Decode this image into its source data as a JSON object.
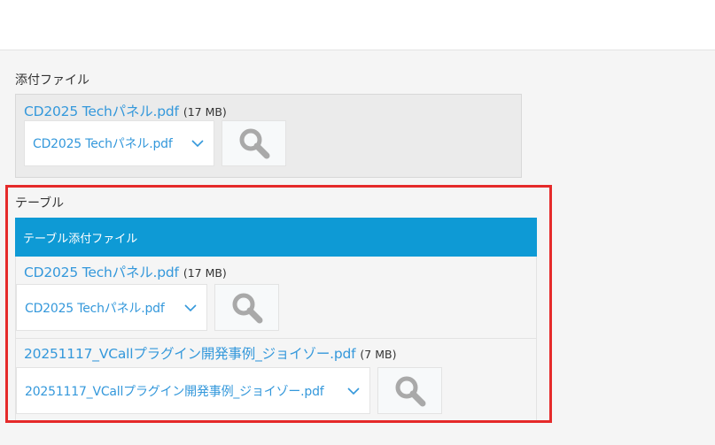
{
  "attachment_section": {
    "label": "添付ファイル",
    "file": {
      "name": "CD2025 Techパネル.pdf",
      "size": "(17 MB)",
      "select_value": "CD2025 Techパネル.pdf"
    }
  },
  "table_section": {
    "label": "テーブル",
    "column_header": "テーブル添付ファイル",
    "rows": [
      {
        "file_name": "CD2025 Techパネル.pdf",
        "file_size": "(17 MB)",
        "select_value": "CD2025 Techパネル.pdf"
      },
      {
        "file_name": "20251117_VCallプラグイン開発事例_ジョイゾー.pdf",
        "file_size": "(7 MB)",
        "select_value": "20251117_VCallプラグイン開発事例_ジョイゾー.pdf"
      }
    ]
  },
  "colors": {
    "link": "#3498db",
    "header_bg": "#0e9ad5",
    "highlight": "#e52a2a",
    "icon": "#a9a9a9"
  },
  "icons": {
    "search": "search-icon",
    "dropdown": "chevron-down-icon"
  }
}
